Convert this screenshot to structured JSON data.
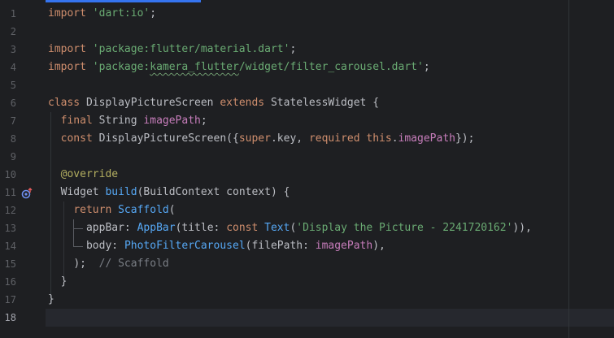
{
  "editor": {
    "current_line": 18,
    "line_numbers": [
      "1",
      "2",
      "3",
      "4",
      "5",
      "6",
      "7",
      "8",
      "9",
      "10",
      "11",
      "12",
      "13",
      "14",
      "15",
      "16",
      "17",
      "18"
    ],
    "gutter_icon": "override-up-arrow-icon"
  },
  "code": {
    "l1": {
      "kw": "import",
      "str": "'dart:io'",
      "end": ";"
    },
    "l3": {
      "kw": "import",
      "str": "'package:flutter/material.dart'",
      "end": ";"
    },
    "l4": {
      "kw": "import",
      "str_a": "'package:",
      "str_typo": "kamera_flutter",
      "str_b": "/widget/filter_carousel.dart'",
      "end": ";"
    },
    "l6": {
      "kw1": "class",
      "name": "DisplayPictureScreen",
      "kw2": "extends",
      "base": "StatelessWidget",
      "end": "{"
    },
    "l7": {
      "kw": "final",
      "type": "String",
      "field": "imagePath",
      "end": ";"
    },
    "l8": {
      "kw": "const",
      "name": "DisplayPictureScreen",
      "p1": "({",
      "kw_super": "super",
      "p2": ".key, ",
      "kw_req": "required",
      "kw_this": "this",
      "p3": ".",
      "field": "imagePath",
      "end": "});"
    },
    "l10": {
      "anno": "@override"
    },
    "l11": {
      "type": "Widget",
      "fn": "build",
      "params": "(BuildContext context) {"
    },
    "l12": {
      "kw": "return",
      "fn": "Scaffold",
      "end": "("
    },
    "l13": {
      "prop": "appBar: ",
      "fn": "AppBar",
      "p1": "(title: ",
      "kw": "const",
      "fn2": "Text",
      "p2": "(",
      "str": "'Display the Picture - 2241720162'",
      "end": ")),"
    },
    "l14": {
      "prop": "body: ",
      "fn": "PhotoFilterCarousel",
      "p1": "(filePath: ",
      "field": "imagePath",
      "end": "),"
    },
    "l15": {
      "code": ");",
      "comment": "// Scaffold"
    },
    "l16": {
      "code": "}"
    },
    "l17": {
      "code": "}"
    }
  }
}
